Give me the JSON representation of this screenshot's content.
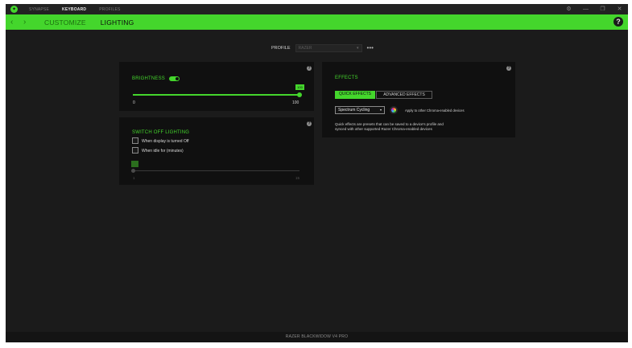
{
  "titlebar": {
    "logo_icon": "razer-logo-icon",
    "tabs": [
      {
        "label": "SYNAPSE",
        "active": false
      },
      {
        "label": "KEYBOARD",
        "active": true
      },
      {
        "label": "PROFILES",
        "active": false
      }
    ],
    "controls": {
      "settings": "⚙",
      "minimize": "—",
      "maximize": "❐",
      "close": "✕"
    }
  },
  "navbar": {
    "back_icon": "‹",
    "forward_icon": "›",
    "tabs": [
      {
        "label": "CUSTOMIZE",
        "active": false
      },
      {
        "label": "LIGHTING",
        "active": true
      }
    ],
    "help": "?"
  },
  "profile": {
    "label": "PROFILE",
    "value": "RAZER",
    "more": "•••"
  },
  "brightness_panel": {
    "title": "BRIGHTNESS",
    "toggle_on": true,
    "slider": {
      "value": "100",
      "min": "0",
      "max": "100",
      "fraction": 1.0
    }
  },
  "switch_off_panel": {
    "title": "SWITCH OFF LIGHTING",
    "options": [
      {
        "label": "When display is turned Off",
        "checked": false
      },
      {
        "label": "When idle for (minutes)",
        "checked": false
      }
    ],
    "slider": {
      "value": "",
      "min": "1",
      "max": "15",
      "fraction": 0.0
    }
  },
  "effects_panel": {
    "title": "EFFECTS",
    "tabs": [
      {
        "label": "QUICK EFFECTS",
        "active": true
      },
      {
        "label": "ADVANCED EFFECTS",
        "active": false
      }
    ],
    "effect_select": "Spectrum Cycling",
    "apply_label": "Apply to other Chroma-enabled devices",
    "description_line1": "Quick effects are presets that can be saved to a device's profile and",
    "description_line2": "synced with other supported Razer Chroma-enabled devices"
  },
  "info_icon": "?",
  "statusbar": {
    "device": "RAZER BLACKWIDOW V4 PRO"
  },
  "colors": {
    "accent": "#44d62c",
    "background": "#1b1b1b",
    "panel": "#101010"
  }
}
